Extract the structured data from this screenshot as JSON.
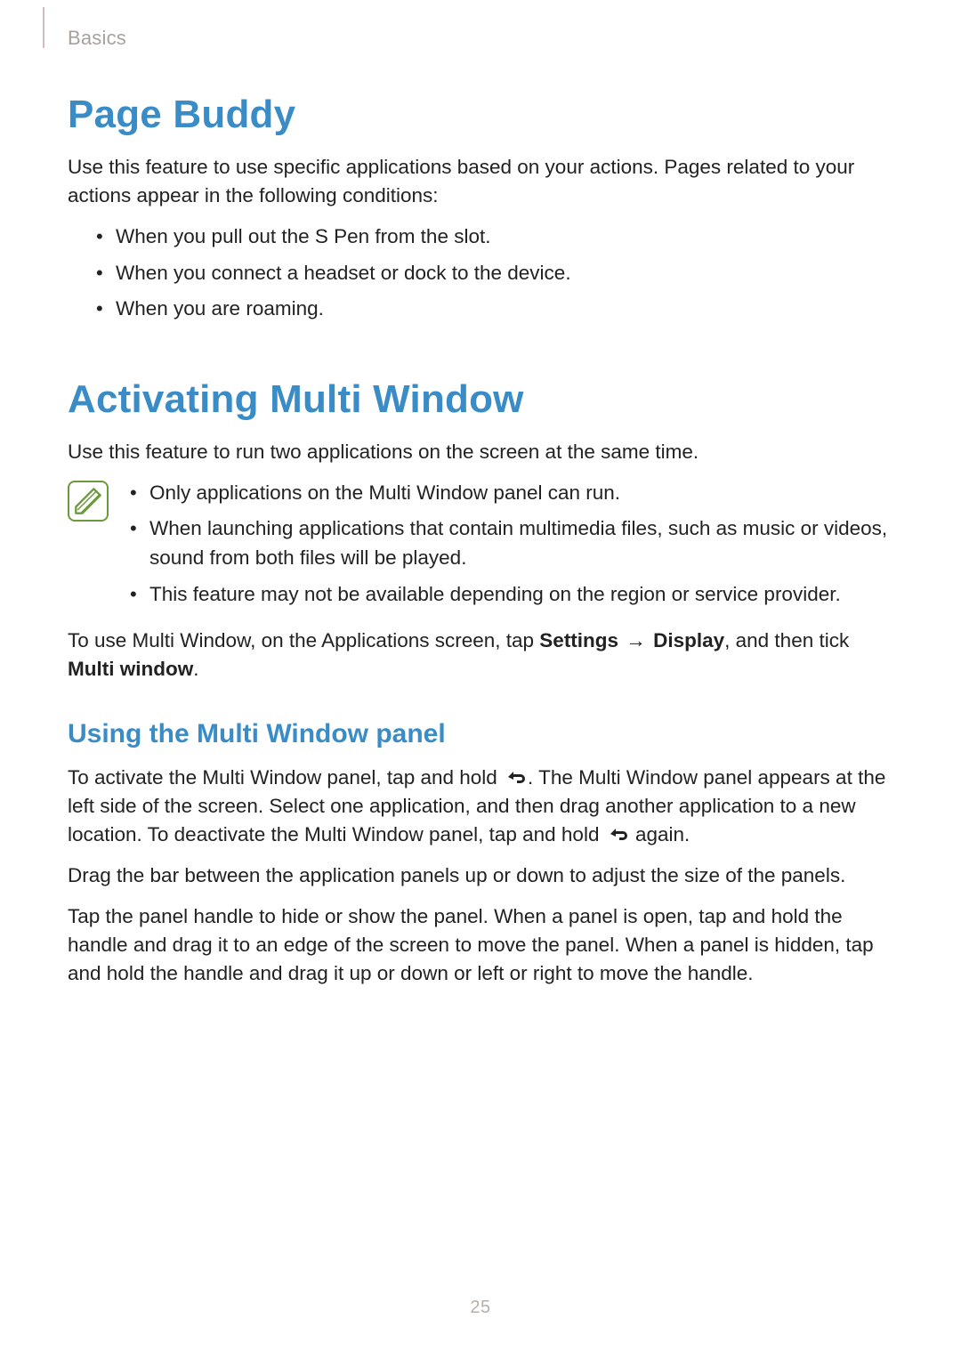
{
  "header": {
    "section_label": "Basics"
  },
  "page_number": "25",
  "sections": {
    "page_buddy": {
      "title": "Page Buddy",
      "intro": "Use this feature to use specific applications based on your actions. Pages related to your actions appear in the following conditions:",
      "bullets": [
        "When you pull out the S Pen from the slot.",
        "When you connect a headset or dock to the device.",
        "When you are roaming."
      ]
    },
    "multi_window": {
      "title": "Activating Multi Window",
      "intro": "Use this feature to run two applications on the screen at the same time.",
      "note_bullets": [
        "Only applications on the Multi Window panel can run.",
        "When launching applications that contain multimedia files, such as music or videos, sound from both files will be played.",
        "This feature may not be available depending on the region or service provider."
      ],
      "instruction": {
        "pre": "To use Multi Window, on the Applications screen, tap ",
        "settings": "Settings",
        "arrow": "→",
        "display": "Display",
        "mid": ", and then tick ",
        "multi_window": "Multi window",
        "post": "."
      },
      "subsection": {
        "title": "Using the Multi Window panel",
        "p1": {
          "a": "To activate the Multi Window panel, tap and hold ",
          "b": ". The Multi Window panel appears at the left side of the screen. Select one application, and then drag another application to a new location. To deactivate the Multi Window panel, tap and hold ",
          "c": " again."
        },
        "p2": "Drag the bar between the application panels up or down to adjust the size of the panels.",
        "p3": "Tap the panel handle to hide or show the panel. When a panel is open, tap and hold the handle and drag it to an edge of the screen to move the panel. When a panel is hidden, tap and hold the handle and drag it up or down or left or right to move the handle."
      }
    }
  }
}
